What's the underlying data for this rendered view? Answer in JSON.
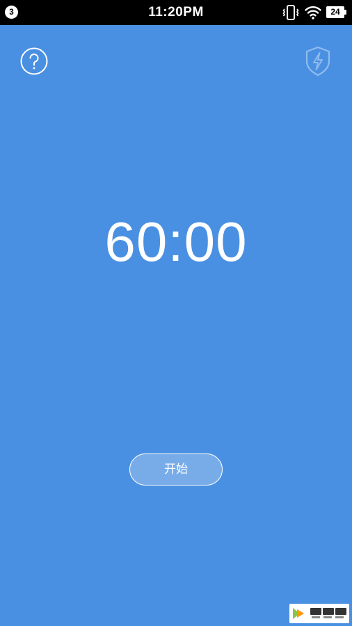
{
  "status_bar": {
    "notification_count": "3",
    "time": "11:20PM",
    "battery_level": "24",
    "icons": [
      "vibrate-icon",
      "wifi-icon",
      "battery-icon"
    ]
  },
  "toolbar": {
    "help_icon": "help-circle-icon",
    "shield_icon": "shield-bolt-icon"
  },
  "timer": {
    "display": "60:00"
  },
  "actions": {
    "start_label": "开始"
  },
  "watermark": {
    "icon": "kuaipan-logo-icon"
  },
  "colors": {
    "background": "#4a90e2",
    "status_bar": "#000000",
    "foreground": "#ffffff",
    "shield_outline": "#8fbcee"
  }
}
